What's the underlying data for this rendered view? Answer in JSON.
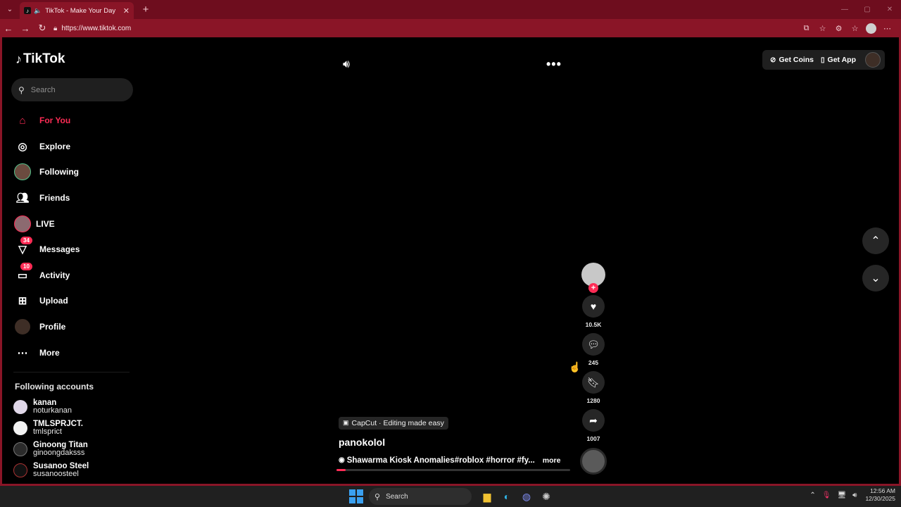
{
  "browser": {
    "tab_title": "TikTok - Make Your Day",
    "url": "https://www.tiktok.com"
  },
  "sidebar": {
    "logo": "TikTok",
    "search_placeholder": "Search",
    "nav": [
      {
        "label": "For You",
        "icon": "home-icon",
        "active": true
      },
      {
        "label": "Explore",
        "icon": "compass-icon"
      },
      {
        "label": "Following",
        "icon": "avatar"
      },
      {
        "label": "Friends",
        "icon": "friends-icon"
      },
      {
        "label": "LIVE",
        "icon": "live-avatar"
      },
      {
        "label": "Messages",
        "icon": "messages-icon",
        "badge": "34"
      },
      {
        "label": "Activity",
        "icon": "activity-icon",
        "badge": "10"
      },
      {
        "label": "Upload",
        "icon": "upload-icon"
      },
      {
        "label": "Profile",
        "icon": "profile-avatar"
      },
      {
        "label": "More",
        "icon": "more-icon"
      }
    ],
    "following_title": "Following accounts",
    "accounts": [
      {
        "name": "kanan",
        "handle": "noturkanan"
      },
      {
        "name": "TMLSPRJCT.",
        "handle": "tmlsprict"
      },
      {
        "name": "Ginoong Titan",
        "handle": "ginoongdaksss"
      },
      {
        "name": "Susanoo Steel",
        "handle": "susanoosteel"
      }
    ]
  },
  "header": {
    "get_coins": "Get Coins",
    "get_app": "Get App"
  },
  "video": {
    "capcut_label": "CapCut · Editing made easy",
    "author": "panokolol",
    "description": "Shawarma Kiosk Anomalies#roblox #horror #fy...",
    "more_label": "more",
    "progress": 0.04,
    "likes": "10.5K",
    "comments": "245",
    "saves": "1280",
    "shares": "1007"
  },
  "taskbar": {
    "search_label": "Search",
    "time": "12:56 AM",
    "date": "12/30/2025"
  },
  "colors": {
    "accent": "#fe2c55",
    "browser_frame": "#8a1527"
  }
}
